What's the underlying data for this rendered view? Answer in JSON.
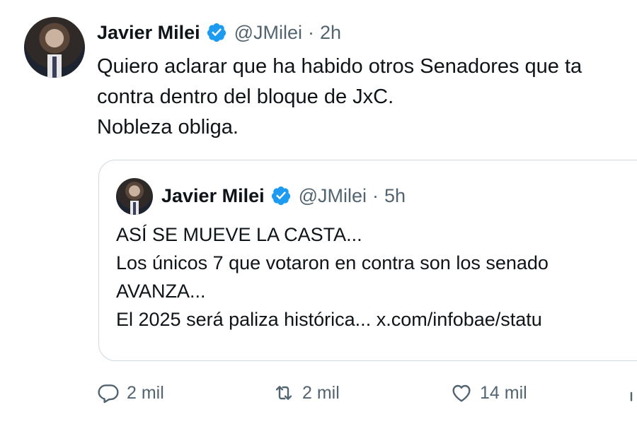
{
  "tweet": {
    "author_name": "Javier Milei",
    "handle": "@JMilei",
    "separator": "·",
    "time": "2h",
    "text": "Quiero aclarar que ha habido otros Senadores que ta\ncontra dentro del bloque de JxC.\nNobleza obliga."
  },
  "quoted_tweet": {
    "author_name": "Javier Milei",
    "handle": "@JMilei",
    "separator": "·",
    "time": "5h",
    "text": "ASÍ SE MUEVE LA CASTA...\nLos únicos 7 que votaron en contra son los senado\nAVANZA...\nEl 2025 será paliza histórica... x.com/infobae/statu"
  },
  "actions": {
    "replies": "2 mil",
    "retweets": "2 mil",
    "likes": "14 mil"
  },
  "colors": {
    "verified_badge": "#1d9bf0",
    "secondary_text": "#536471",
    "border": "#cfd9de"
  },
  "icons": [
    "avatar",
    "verified-badge-icon",
    "reply-icon",
    "retweet-icon",
    "like-icon",
    "stats-icon"
  ]
}
